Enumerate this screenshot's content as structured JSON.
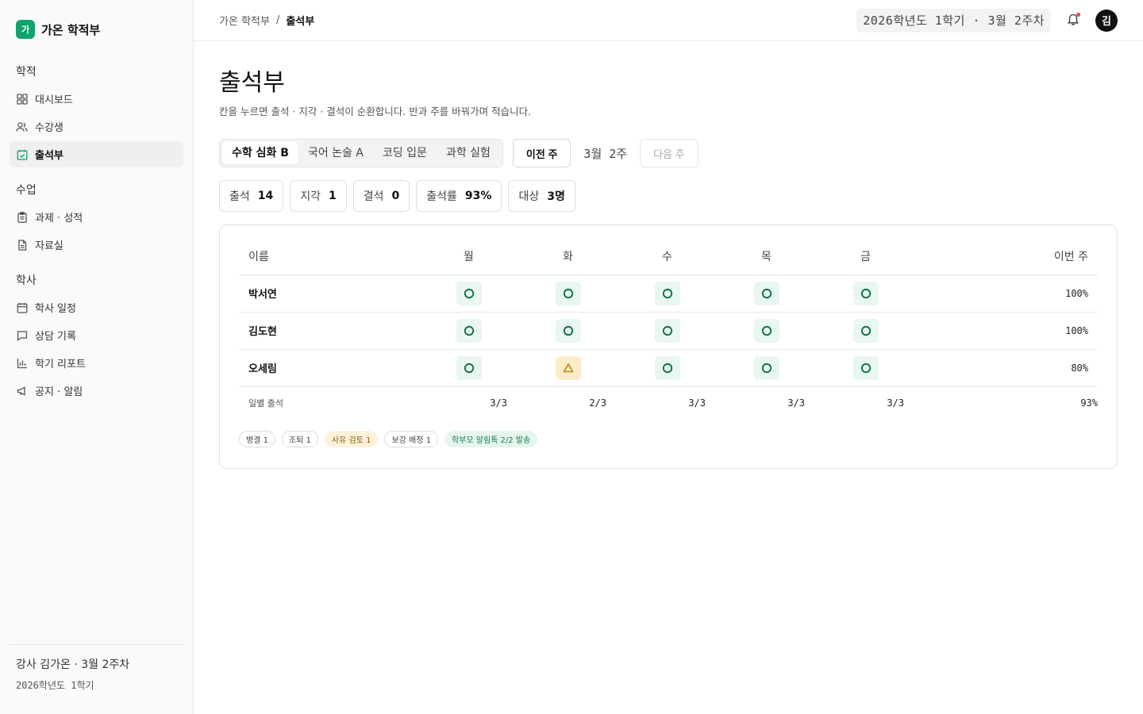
{
  "brand": {
    "logo": "가",
    "name": "가온 학적부"
  },
  "sidebar": {
    "sections": [
      {
        "title": "학적",
        "items": [
          {
            "label": "대시보드",
            "icon": "grid-icon"
          },
          {
            "label": "수강생",
            "icon": "users-icon"
          },
          {
            "label": "출석부",
            "icon": "calendar-check-icon",
            "active": true
          }
        ]
      },
      {
        "title": "수업",
        "items": [
          {
            "label": "과제 · 성적",
            "icon": "clipboard-icon"
          },
          {
            "label": "자료실",
            "icon": "file-icon"
          }
        ]
      },
      {
        "title": "학사",
        "items": [
          {
            "label": "학사 일정",
            "icon": "calendar-icon"
          },
          {
            "label": "상담 기록",
            "icon": "chat-icon"
          },
          {
            "label": "학기 리포트",
            "icon": "bar-chart-icon"
          },
          {
            "label": "공지 · 알림",
            "icon": "megaphone-icon"
          }
        ]
      }
    ],
    "footer": {
      "line1": "강사 김가온 · 3월 2주차",
      "line2": "2026학년도 1학기"
    }
  },
  "topbar": {
    "breadcrumb": {
      "parent": "가온 학적부",
      "separator": "/",
      "current": "출석부"
    },
    "term": "2026학년도 1학기 · 3월 2주차",
    "avatar": "김"
  },
  "page": {
    "title": "출석부",
    "description": "칸을 누르면 출석 · 지각 · 결석이 순환합니다. 반과 주를 바꿔가며 적습니다."
  },
  "class_tabs": [
    "수학 심화 B",
    "국어 논술 A",
    "코딩 입문",
    "과학 실험"
  ],
  "active_class": 0,
  "week_nav": {
    "prev": "이전 주",
    "label": "3월 2주",
    "next": "다음 주"
  },
  "stats": [
    {
      "label": "출석",
      "value": "14"
    },
    {
      "label": "지각",
      "value": "1"
    },
    {
      "label": "결석",
      "value": "0"
    },
    {
      "label": "출석률",
      "value": "93%"
    },
    {
      "label": "대상",
      "value": "3명"
    }
  ],
  "table": {
    "headers": {
      "name": "이름",
      "days": [
        "월",
        "화",
        "수",
        "목",
        "금"
      ],
      "week": "이번 주"
    },
    "rows": [
      {
        "name": "박서연",
        "marks": [
          "O",
          "O",
          "O",
          "O",
          "O"
        ],
        "week": "100%"
      },
      {
        "name": "김도현",
        "marks": [
          "O",
          "O",
          "O",
          "O",
          "O"
        ],
        "week": "100%"
      },
      {
        "name": "오세림",
        "marks": [
          "O",
          "△",
          "O",
          "O",
          "O"
        ],
        "week": "80%"
      }
    ],
    "daily": {
      "label": "일별 출석",
      "values": [
        "3/3",
        "2/3",
        "3/3",
        "3/3",
        "3/3"
      ],
      "week": "93%"
    }
  },
  "tags": [
    {
      "label": "병결 1",
      "style": "default"
    },
    {
      "label": "조퇴 1",
      "style": "default"
    },
    {
      "label": "사유 검토 1",
      "style": "warn"
    },
    {
      "label": "보강 배정 1",
      "style": "default"
    },
    {
      "label": "학부모 알림톡 2/2 발송",
      "style": "success"
    }
  ],
  "colors": {
    "accent": "#11a36b",
    "present_bg": "#e8f7ef",
    "present_fg": "#0b6b45",
    "late_bg": "#fcecc8",
    "late_fg": "#b8860b",
    "notify_dot": "#e5484d"
  }
}
